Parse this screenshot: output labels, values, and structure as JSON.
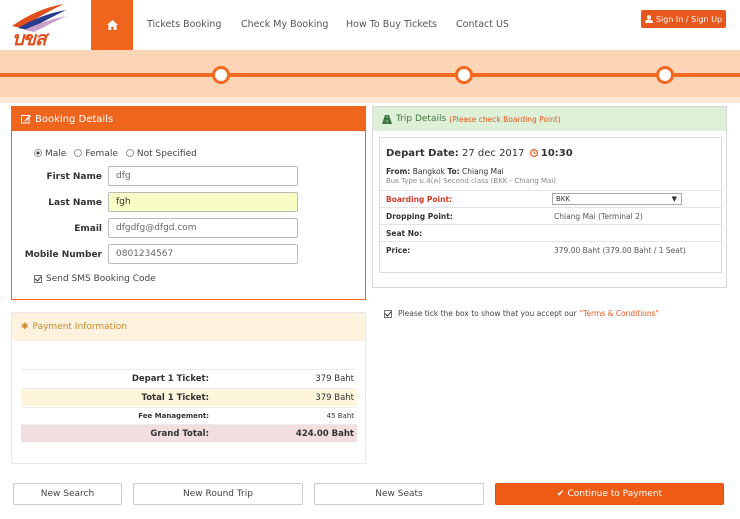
{
  "brand": {
    "logo_text": "บขส",
    "accent": "#f0651e"
  },
  "nav": {
    "items": [
      "Tickets Booking",
      "Check My Booking",
      "How To Buy Tickets",
      "Contact US"
    ],
    "signin_label": "Sign In / Sign Up"
  },
  "booking": {
    "title": "Booking Details",
    "gender_options": [
      "Male",
      "Female",
      "Not Specified"
    ],
    "gender_selected": "Male",
    "first_name_label": "First Name",
    "first_name_value": "dfg",
    "last_name_label": "Last Name",
    "last_name_value": "fgh",
    "email_label": "Email",
    "email_value": "dfgdfg@dfgd.com",
    "mobile_label": "Mobile Number",
    "mobile_value": "0801234567",
    "sms_label": "Send SMS Booking Code"
  },
  "trip": {
    "title": "Trip Details",
    "title_note": "(Please check Boarding Point)",
    "depart_label": "Depart Date:",
    "depart_date": "27 dec 2017",
    "depart_time": "10:30",
    "from_label": "From:",
    "from_value": "Bangkok",
    "to_label": "To:",
    "to_value": "Chiang Mai",
    "bus_type": "Bus Type ม.4(ค) Second class (BKK - Chiang Mai)",
    "boarding_label": "Boarding Point:",
    "boarding_value": "BKK",
    "dropping_label": "Dropping Point:",
    "dropping_value": "Chiang Mai (Terminal 2)",
    "seat_label": "Seat No:",
    "seat_value": "",
    "price_label": "Price:",
    "price_value": "379.00 Baht (379.00 Baht / 1 Seat)"
  },
  "terms": {
    "text": "Please tick the box to show that you accept our",
    "link": "\"Terms & Conditions\""
  },
  "payment": {
    "title": "Payment Information",
    "rows": [
      {
        "label": "Depart 1 Ticket:",
        "value": "379 Baht"
      },
      {
        "label": "Total 1 Ticket:",
        "value": "379 Baht"
      },
      {
        "label": "Fee Management:",
        "value": "45 Baht"
      },
      {
        "label": "Grand Total:",
        "value": "424.00 Baht"
      }
    ]
  },
  "actions": {
    "new_search": "New Search",
    "new_round_trip": "New Round Trip",
    "new_seats": "New Seats",
    "continue": "Continue to Payment"
  }
}
